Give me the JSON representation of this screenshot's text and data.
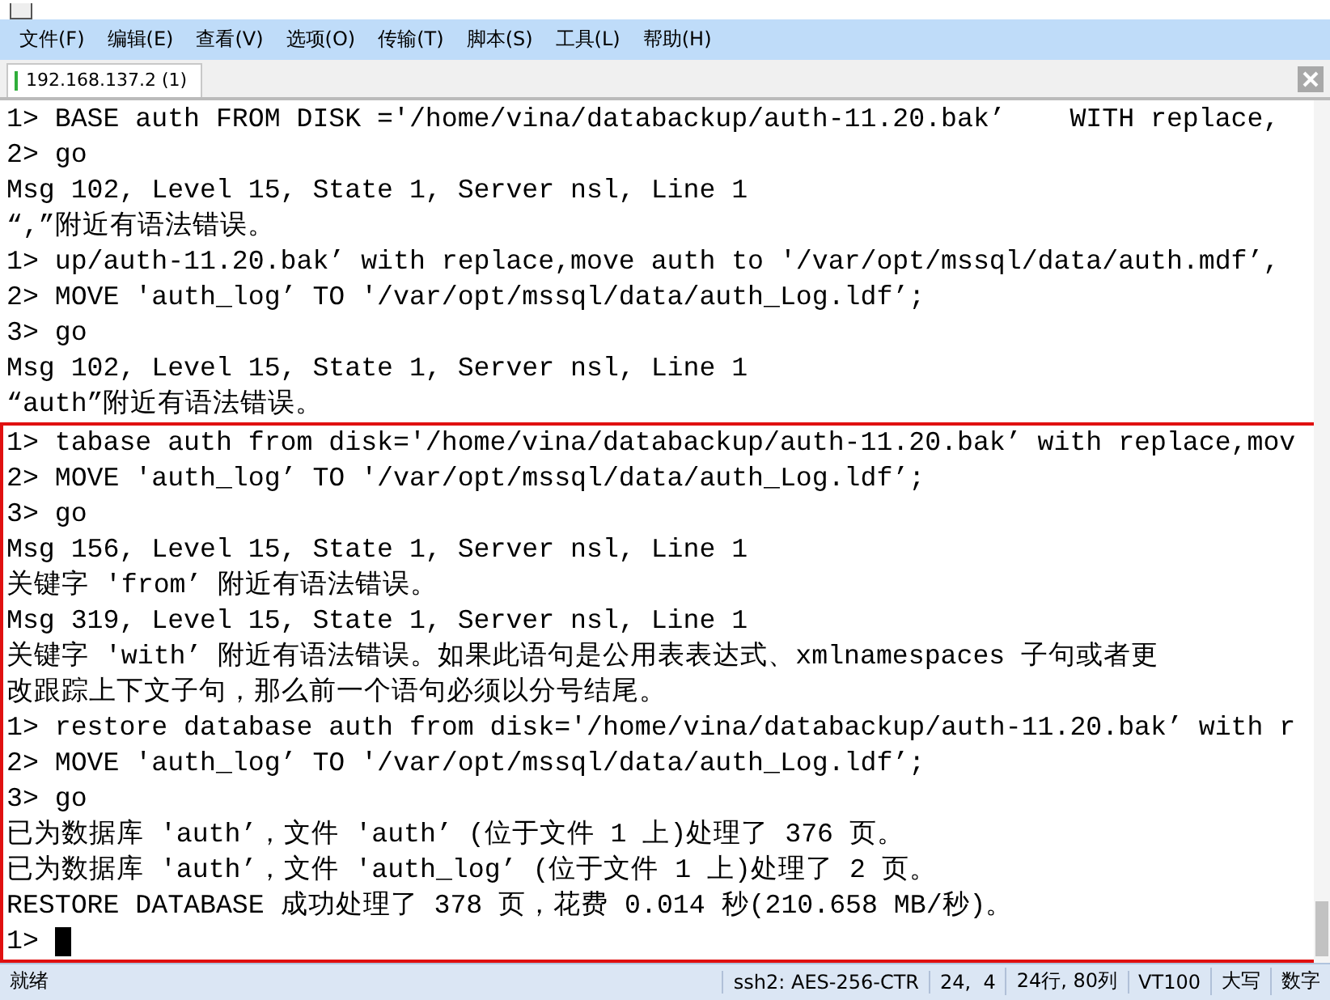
{
  "menu": [
    "文件(F)",
    "编辑(E)",
    "查看(V)",
    "选项(O)",
    "传输(T)",
    "脚本(S)",
    "工具(L)",
    "帮助(H)"
  ],
  "tabs": [
    {
      "label": "192.168.137.2 (1)",
      "selected": true,
      "connected": true
    }
  ],
  "terminal": {
    "lines": [
      "1> BASE auth FROM DISK ='/home/vina/databackup/auth-11.20.bak’    WITH replace,",
      "2> go",
      "Msg 102, Level 15, State 1, Server nsl, Line 1",
      "“,”附近有语法错误。",
      "1> up/auth-11.20.bak’ with replace,move auth to '/var/opt/mssql/data/auth.mdf’,",
      "2> MOVE 'auth_log’ TO '/var/opt/mssql/data/auth_Log.ldf’;",
      "3> go",
      "Msg 102, Level 15, State 1, Server nsl, Line 1",
      "“auth”附近有语法错误。"
    ],
    "highlighted_lines": [
      "1> tabase auth from disk='/home/vina/databackup/auth-11.20.bak’ with replace,mov",
      "2> MOVE 'auth_log’ TO '/var/opt/mssql/data/auth_Log.ldf’;",
      "3> go",
      "Msg 156, Level 15, State 1, Server nsl, Line 1",
      "关键字 'from’ 附近有语法错误。",
      "Msg 319, Level 15, State 1, Server nsl, Line 1",
      "关键字 'with’ 附近有语法错误。如果此语句是公用表表达式、xmlnamespaces 子句或者更",
      "改跟踪上下文子句，那么前一个语句必须以分号结尾。",
      "1> restore database auth from disk='/home/vina/databackup/auth-11.20.bak’ with r",
      "2> MOVE 'auth_log’ TO '/var/opt/mssql/data/auth_Log.ldf’;",
      "3> go",
      "已为数据库 'auth’，文件 'auth’ (位于文件 1 上)处理了 376 页。",
      "已为数据库 'auth’，文件 'auth_log’ (位于文件 1 上)处理了 2 页。",
      "RESTORE DATABASE 成功处理了 378 页，花费 0.014 秒(210.658 MB/秒)。"
    ],
    "prompt": {
      "text": "1> ",
      "cursor": true
    }
  },
  "status_bar": [
    "就绪",
    "ssh2: AES-256-CTR",
    "24,  4",
    "24行, 80列",
    "VT100",
    "大写",
    "数字"
  ]
}
